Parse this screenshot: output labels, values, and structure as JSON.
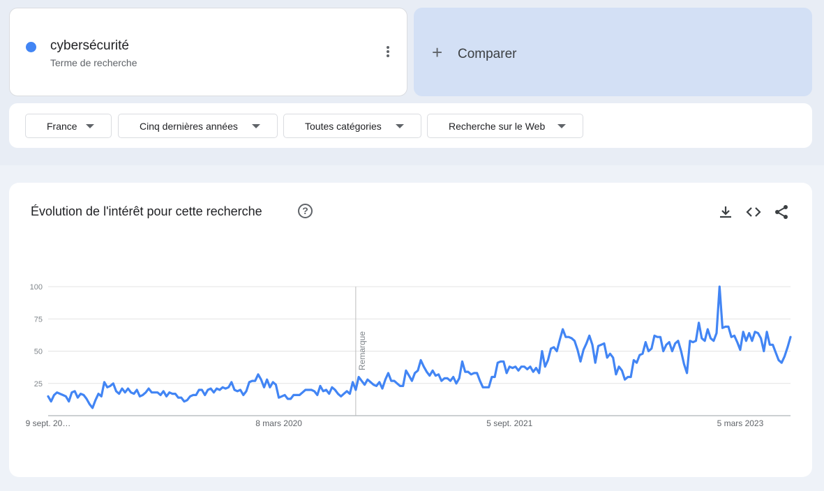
{
  "term": {
    "name": "cybersécurité",
    "subtitle": "Terme de recherche",
    "color": "#4285f4"
  },
  "compare": {
    "label": "Comparer"
  },
  "filters": {
    "region": "France",
    "period": "Cinq dernières années",
    "category": "Toutes catégories",
    "type": "Recherche sur le Web"
  },
  "chart": {
    "title": "Évolution de l'intérêt pour cette recherche",
    "icons": {
      "help": "help-circle-icon",
      "download": "download-icon",
      "embed": "embed-code-icon",
      "share": "share-icon"
    }
  },
  "chart_data": {
    "type": "line",
    "title": "Évolution de l'intérêt pour cette recherche",
    "xlabel": "",
    "ylabel": "",
    "ylim": [
      0,
      100
    ],
    "yticks": [
      25,
      50,
      75,
      100
    ],
    "grid": true,
    "legend": "none",
    "x_tick_labels": [
      "9 sept. 20…",
      "8 mars 2020",
      "5 sept. 2021",
      "5 mars 2023"
    ],
    "annotation": {
      "label": "Remarque",
      "week_index": 104
    },
    "series": [
      {
        "color": "#4285f4",
        "values": [
          15,
          11,
          16,
          18,
          17,
          16,
          15,
          11,
          18,
          19,
          14,
          17,
          16,
          13,
          9,
          6,
          12,
          17,
          15,
          26,
          22,
          23,
          25,
          19,
          17,
          21,
          18,
          21,
          18,
          17,
          20,
          15,
          16,
          18,
          21,
          18,
          18,
          18,
          16,
          19,
          15,
          18,
          17,
          17,
          14,
          14,
          11,
          12,
          15,
          16,
          16,
          20,
          20,
          16,
          20,
          21,
          18,
          21,
          20,
          22,
          21,
          22,
          26,
          20,
          19,
          20,
          16,
          19,
          26,
          27,
          27,
          32,
          28,
          22,
          28,
          22,
          26,
          24,
          14,
          15,
          16,
          13,
          13,
          16,
          16,
          16,
          18,
          20,
          20,
          20,
          19,
          16,
          23,
          19,
          20,
          17,
          22,
          20,
          17,
          15,
          17,
          19,
          17,
          26,
          20,
          30,
          27,
          24,
          28,
          26,
          24,
          23,
          26,
          21,
          28,
          33,
          27,
          27,
          25,
          23,
          23,
          35,
          31,
          27,
          33,
          35,
          43,
          38,
          34,
          31,
          35,
          31,
          32,
          27,
          29,
          29,
          27,
          30,
          25,
          29,
          42,
          34,
          34,
          32,
          33,
          33,
          27,
          22,
          22,
          22,
          30,
          30,
          41,
          42,
          42,
          33,
          38,
          37,
          38,
          35,
          38,
          38,
          36,
          38,
          34,
          37,
          33,
          50,
          38,
          43,
          52,
          53,
          50,
          59,
          67,
          61,
          61,
          60,
          58,
          51,
          42,
          51,
          56,
          62,
          55,
          41,
          54,
          55,
          56,
          45,
          48,
          45,
          32,
          38,
          35,
          28,
          30,
          30,
          43,
          41,
          47,
          48,
          57,
          50,
          52,
          62,
          61,
          61,
          50,
          55,
          57,
          50,
          56,
          58,
          50,
          40,
          33,
          58,
          57,
          58,
          72,
          60,
          58,
          67,
          60,
          58,
          64,
          100,
          68,
          69,
          69,
          61,
          62,
          57,
          51,
          65,
          58,
          64,
          58,
          65,
          64,
          60,
          50,
          65,
          55,
          55,
          49,
          43,
          41,
          46,
          53,
          61
        ]
      }
    ]
  }
}
